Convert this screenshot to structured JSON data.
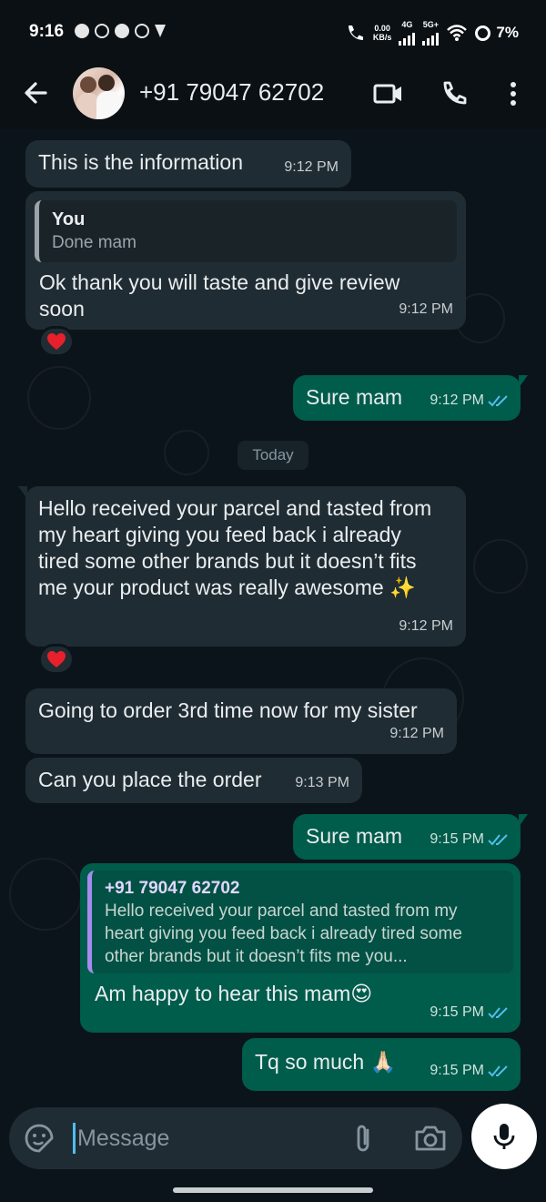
{
  "status_bar": {
    "time": "9:16",
    "net_speed_value": "0.00",
    "net_speed_unit": "KB/s",
    "sim1_label": "4G",
    "sim2_label": "5G+",
    "battery": "7%"
  },
  "header": {
    "contact": "+91 79047 62702",
    "icons": [
      "back-arrow-icon",
      "video-call-icon",
      "phone-call-icon",
      "more-options-icon"
    ]
  },
  "chat": {
    "day_label": "Today",
    "messages": [
      {
        "direction": "in",
        "text": "This is the information",
        "time": "9:12 PM"
      },
      {
        "direction": "in",
        "quote_name": "You",
        "quote_text": "Done mam",
        "text": "Ok thank you will taste and give review soon",
        "time": "9:12 PM",
        "reaction": "❤️"
      },
      {
        "direction": "out",
        "text": "Sure mam",
        "time": "9:12 PM",
        "status": "read"
      },
      {
        "direction": "in",
        "text": "Hello received your parcel and tasted from my heart giving you feed back i already tired some other brands but it doesn’t fits me your product was really awesome ✨",
        "time": "9:12 PM",
        "reaction": "❤️"
      },
      {
        "direction": "in",
        "text": "Going to order 3rd time now for my sister",
        "time": "9:12 PM"
      },
      {
        "direction": "in",
        "text": "Can you place the order",
        "time": "9:13 PM"
      },
      {
        "direction": "out",
        "text": "Sure mam",
        "time": "9:15 PM",
        "status": "read"
      },
      {
        "direction": "out",
        "quote_name": "+91 79047 62702",
        "quote_text": "Hello received your parcel and tasted from my heart giving you feed back i already tired some other brands but it doesn’t fits me you...",
        "text": "Am happy to hear this mam😍",
        "time": "9:15 PM",
        "status": "read"
      },
      {
        "direction": "out",
        "text": "Tq so much 🙏🏻",
        "time": "9:15 PM",
        "status": "read"
      }
    ]
  },
  "composer": {
    "placeholder": "Message",
    "icons": [
      "emoji-sticker-icon",
      "attach-icon",
      "camera-icon",
      "mic-icon"
    ]
  },
  "colors": {
    "incoming_bubble": "#202c33",
    "outgoing_bubble": "#005c4b",
    "background": "#0b141a",
    "read_ticks": "#53bdeb"
  }
}
